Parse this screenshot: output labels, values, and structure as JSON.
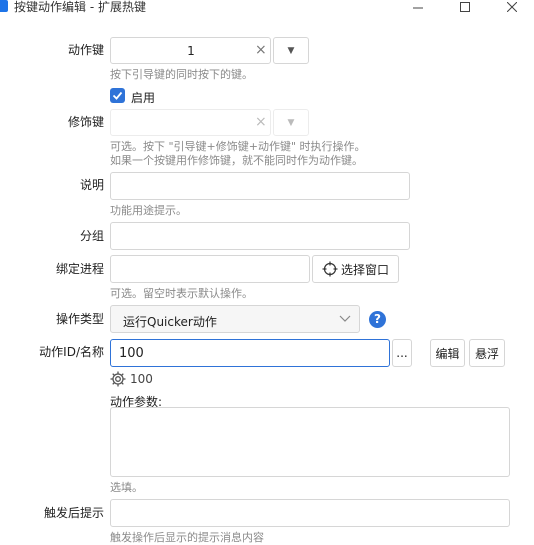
{
  "window": {
    "title": "按键动作编辑 - 扩展热键"
  },
  "form": {
    "action_key": {
      "label": "动作键",
      "value": "1",
      "hint": "按下引导键的同时按下的键。"
    },
    "enabled": {
      "label": "启用",
      "checked": true
    },
    "modifier": {
      "label": "修饰键",
      "value": "",
      "hint1": "可选。按下 \"引导键+修饰键+动作键\" 时执行操作。",
      "hint2": "如果一个按键用作修饰键，就不能同时作为动作键。"
    },
    "description": {
      "label": "说明",
      "value": "",
      "hint": "功能用途提示。"
    },
    "group": {
      "label": "分组",
      "value": ""
    },
    "bind_process": {
      "label": "绑定进程",
      "value": "",
      "select_button": "选择窗口",
      "hint": "可选。留空时表示默认操作。"
    },
    "operation_type": {
      "label": "操作类型",
      "selected": "运行Quicker动作"
    },
    "action_id": {
      "label": "动作ID/名称",
      "value": "100",
      "more_button": "...",
      "edit_button": "编辑",
      "float_button": "悬浮",
      "gear_value": "100"
    },
    "action_params": {
      "label": "动作参数:",
      "value": "",
      "hint": "选填。"
    },
    "trigger_tip": {
      "label": "触发后提示",
      "value": "",
      "hint": "触发操作后显示的提示消息内容"
    }
  },
  "colors": {
    "accent": "#2f73d8",
    "hint": "#8a8a8a",
    "border": "#d6d6d6"
  }
}
